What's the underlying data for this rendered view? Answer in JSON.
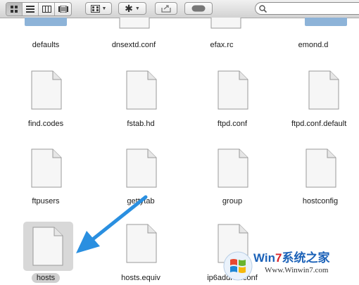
{
  "toolbar": {
    "view_buttons": [
      {
        "name": "icon-view-button",
        "icon": "grid-icon",
        "active": true
      },
      {
        "name": "list-view-button",
        "icon": "list-icon",
        "active": false
      },
      {
        "name": "column-view-button",
        "icon": "columns-icon",
        "active": false
      },
      {
        "name": "coverflow-view-button",
        "icon": "coverflow-icon",
        "active": false
      }
    ],
    "arrange_icon": "arrange-grid-icon",
    "action_icon": "gear-icon",
    "share_icon": "share-icon",
    "tag_icon": "toggle-pill-icon",
    "search": {
      "value": "",
      "placeholder": ""
    }
  },
  "files": [
    {
      "name": "defaults",
      "type": "folder"
    },
    {
      "name": "dnsextd.conf",
      "type": "document"
    },
    {
      "name": "efax.rc",
      "type": "document"
    },
    {
      "name": "emond.d",
      "type": "folder"
    },
    {
      "name": "find.codes",
      "type": "document"
    },
    {
      "name": "fstab.hd",
      "type": "document"
    },
    {
      "name": "ftpd.conf",
      "type": "document"
    },
    {
      "name": "ftpd.conf.default",
      "type": "document"
    },
    {
      "name": "ftpusers",
      "type": "document"
    },
    {
      "name": "gettytab",
      "type": "document"
    },
    {
      "name": "group",
      "type": "document"
    },
    {
      "name": "hostconfig",
      "type": "document"
    },
    {
      "name": "hosts",
      "type": "document",
      "selected": true
    },
    {
      "name": "hosts.equiv",
      "type": "document"
    },
    {
      "name": "ip6addrctl.conf",
      "type": "document"
    }
  ],
  "watermark": {
    "brand_prefix": "Win",
    "brand_seven": "7",
    "brand_suffix": "系统之家",
    "url": "Www.Winwin7.com"
  },
  "colors": {
    "accent_arrow": "#2a8fe0",
    "folder_blue": "#8db3d8",
    "selection": "#d8d8d8"
  }
}
